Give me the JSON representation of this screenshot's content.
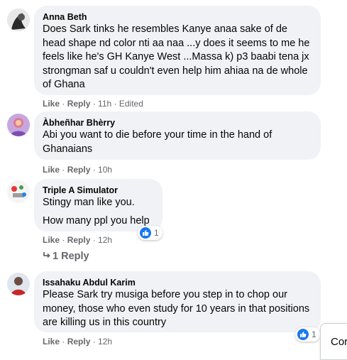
{
  "comments": [
    {
      "author": "Anna Beth",
      "text": "Does Sark tinks he resembles Kanye anaa sake of de head shape nd color nti aa naa ...y does it seems to me he feels like he's GH Kanye West ...Massa k) p3 baabi tena jx strongman saf u couldn't even help him ahiaa na de whole of Ghana",
      "like": "Like",
      "reply": "Reply",
      "time": "11h",
      "edited": "Edited"
    },
    {
      "author": "Àbheñhar Bhèrry",
      "text": "Abi you want to die before your time in the hand of Ghanaians",
      "like": "Like",
      "reply": "Reply",
      "time": "10h"
    },
    {
      "author": "Triple A Simulator",
      "text": "Stingy man like you.",
      "text2": "How many ppl you help",
      "like": "Like",
      "reply": "Reply",
      "time": "12h",
      "reaction_count": "1",
      "replies_label": "1 Reply"
    },
    {
      "author": "Issahaku Abdul Karim",
      "text": "Please Sark try musiga before you step in to chop our money, those who even study for 10 years in that positions are killing us in this country",
      "like": "Like",
      "reply": "Reply",
      "time": "12h",
      "reaction_count": "1"
    }
  ],
  "comment_box_partial": "Cor",
  "colors": {
    "bubble": "#f0f2f5",
    "meta": "#65676b",
    "like_blue": "#1877f2"
  }
}
